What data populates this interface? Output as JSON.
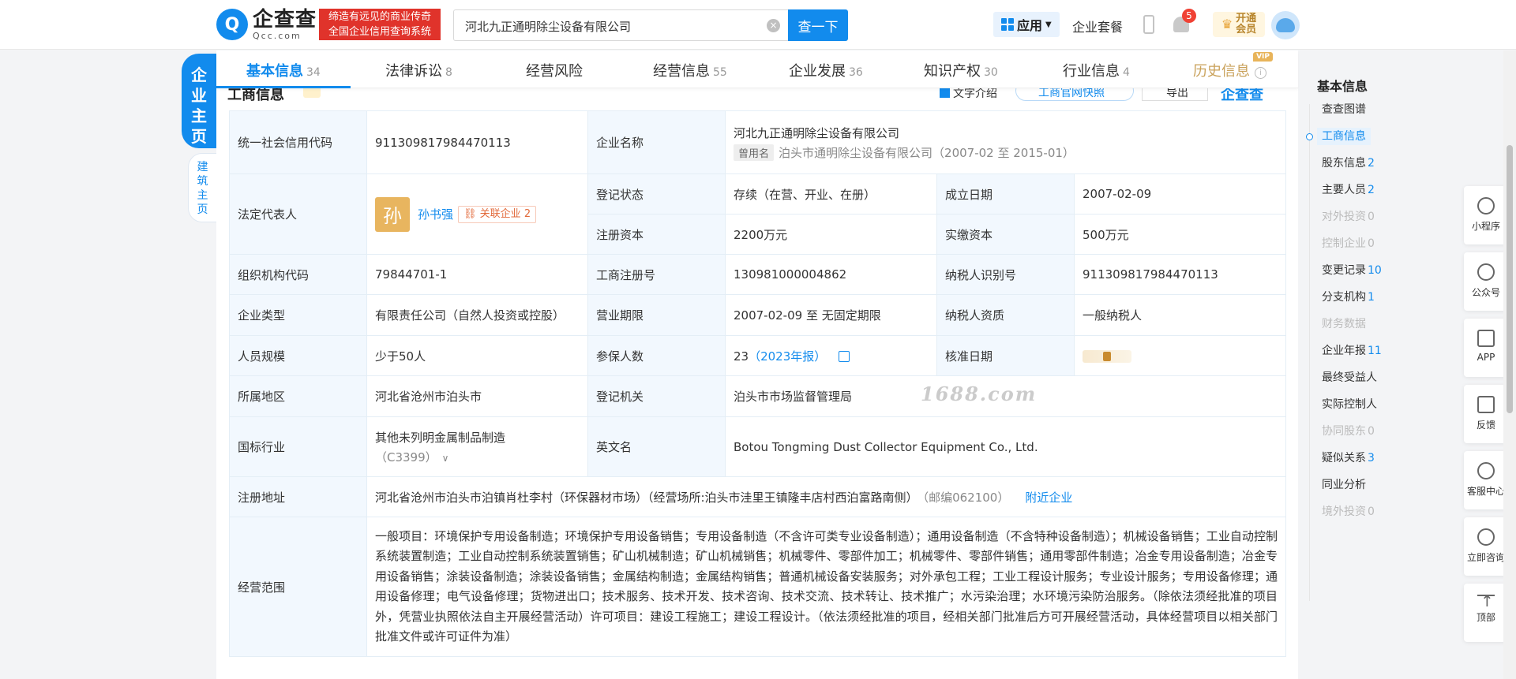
{
  "header": {
    "logo_cn": "企查查",
    "logo_en": "Qcc.com",
    "slogan_line1": "缔造有远见的商业传奇",
    "slogan_line2": "全国企业信用查询系统",
    "search_value": "河北九正通明除尘设备有限公司",
    "search_button": "查一下",
    "app_label": "应用",
    "package_label": "企业套餐",
    "notification_count": "5",
    "vip_line1": "开通",
    "vip_line2": "会员"
  },
  "side_tabs": {
    "home": "企业主页",
    "build": "建筑主页"
  },
  "tabs": [
    {
      "label": "基本信息",
      "count": "34"
    },
    {
      "label": "法律诉讼",
      "count": "8"
    },
    {
      "label": "经营风险",
      "count": ""
    },
    {
      "label": "经营信息",
      "count": "55"
    },
    {
      "label": "企业发展",
      "count": "36"
    },
    {
      "label": "知识产权",
      "count": "30"
    },
    {
      "label": "行业信息",
      "count": "4"
    },
    {
      "label": "历史信息",
      "count": "",
      "tag": "VIP"
    }
  ],
  "section": {
    "title": "工商信息",
    "check_label": "文字介绍",
    "official_btn": "工商官网快照",
    "export_btn": "导出",
    "brand": "企查查"
  },
  "info": {
    "credit_code_label": "统一社会信用代码",
    "credit_code": "911309817984470113",
    "company_name_label": "企业名称",
    "company_name": "河北九正通明除尘设备有限公司",
    "used_name_tag": "曾用名",
    "used_name": "泊头市通明除尘设备有限公司",
    "used_name_period": "（2007-02 至 2015-01）",
    "legal_rep_label": "法定代表人",
    "legal_rep_avatar": "孙",
    "legal_rep_name": "孙书强",
    "related_label": "关联企业",
    "related_count": "2",
    "status_label": "登记状态",
    "status": "存续（在营、开业、在册）",
    "found_date_label": "成立日期",
    "found_date": "2007-02-09",
    "reg_capital_label": "注册资本",
    "reg_capital": "2200万元",
    "paid_capital_label": "实缴资本",
    "paid_capital": "500万元",
    "org_code_label": "组织机构代码",
    "org_code": "79844701-1",
    "reg_no_label": "工商注册号",
    "reg_no": "130981000004862",
    "taxpayer_id_label": "纳税人识别号",
    "taxpayer_id": "911309817984470113",
    "type_label": "企业类型",
    "type": "有限责任公司（自然人投资或控股）",
    "term_label": "营业期限",
    "term": "2007-02-09 至 无固定期限",
    "taxpayer_qual_label": "纳税人资质",
    "taxpayer_qual": "一般纳税人",
    "staff_size_label": "人员规模",
    "staff_size": "少于50人",
    "insured_label": "参保人数",
    "insured": "23",
    "insured_report": "（2023年报）",
    "approve_date_label": "核准日期",
    "region_label": "所属地区",
    "region": "河北省沧州市泊头市",
    "authority_label": "登记机关",
    "authority": "泊头市市场监督管理局",
    "industry_label": "国标行业",
    "industry": "其他未列明金属制品制造",
    "industry_code": "（C3399）",
    "english_name_label": "英文名",
    "english_name": "Botou Tongming Dust Collector Equipment Co., Ltd.",
    "address_label": "注册地址",
    "address": "河北省沧州市泊头市泊镇肖杜李村（环保器材市场）（经营场所:泊头市洼里王镇隆丰店村西泊富路南侧）",
    "postcode": "（邮编062100）",
    "nearby_link": "附近企业",
    "scope_label": "经营范围",
    "scope": "一般项目：环境保护专用设备制造；环境保护专用设备销售；专用设备制造（不含许可类专业设备制造）；通用设备制造（不含特种设备制造）；机械设备销售；工业自动控制系统装置制造；工业自动控制系统装置销售；矿山机械制造；矿山机械销售；机械零件、零部件加工；机械零件、零部件销售；通用零部件制造；冶金专用设备制造；冶金专用设备销售；涂装设备制造；涂装设备销售；金属结构制造；金属结构销售；普通机械设备安装服务；对外承包工程；工业工程设计服务；专业设计服务；专用设备修理；通用设备修理；电气设备修理；货物进出口；技术服务、技术开发、技术咨询、技术交流、技术转让、技术推广；水污染治理；水环境污染防治服务。（除依法须经批准的项目外，凭营业执照依法自主开展经营活动）许可项目：建设工程施工；建设工程设计。（依法须经批准的项目，经相关部门批准后方可开展经营活动，具体经营项目以相关部门批准文件或许可证件为准）"
  },
  "watermark": "1688.com",
  "anchor_nav": {
    "title": "基本信息",
    "items": [
      {
        "label": "查查图谱",
        "count": "",
        "dim": false
      },
      {
        "label": "工商信息",
        "count": "",
        "dim": false,
        "active": true
      },
      {
        "label": "股东信息",
        "count": "2",
        "dim": false
      },
      {
        "label": "主要人员",
        "count": "2",
        "dim": false
      },
      {
        "label": "对外投资",
        "count": "0",
        "dim": true
      },
      {
        "label": "控制企业",
        "count": "0",
        "dim": true
      },
      {
        "label": "变更记录",
        "count": "10",
        "dim": false
      },
      {
        "label": "分支机构",
        "count": "1",
        "dim": false
      },
      {
        "label": "财务数据",
        "count": "",
        "dim": true
      },
      {
        "label": "企业年报",
        "count": "11",
        "dim": false
      },
      {
        "label": "最终受益人",
        "count": "",
        "dim": false
      },
      {
        "label": "实际控制人",
        "count": "",
        "dim": false
      },
      {
        "label": "协同股东",
        "count": "0",
        "dim": true
      },
      {
        "label": "疑似关系",
        "count": "3",
        "dim": false
      },
      {
        "label": "同业分析",
        "count": "",
        "dim": false
      },
      {
        "label": "境外投资",
        "count": "0",
        "dim": true
      }
    ]
  },
  "float_bar": [
    {
      "label": "小程序",
      "icon": "mini-program-icon"
    },
    {
      "label": "公众号",
      "icon": "official-account-icon"
    },
    {
      "label": "APP",
      "icon": "app-icon"
    },
    {
      "label": "反馈",
      "icon": "feedback-icon"
    },
    {
      "label": "客服中心",
      "icon": "customer-service-icon"
    },
    {
      "label": "立即咨询",
      "icon": "consult-icon"
    },
    {
      "label": "顶部",
      "icon": "back-to-top-icon"
    }
  ],
  "colors": {
    "brand": "#128bed",
    "slogan_bg": "#e0332b",
    "label_bg": "#f2f8fe"
  }
}
